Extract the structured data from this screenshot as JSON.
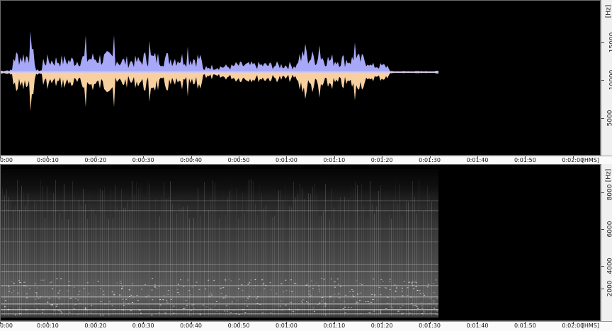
{
  "waveform": {
    "y_axis_unit": "[Hz]",
    "y_ticks": [
      "15000",
      "10000",
      "5000"
    ],
    "colors": {
      "upper": "#a8a8f8",
      "lower": "#f8d0a0",
      "background": "#000000"
    },
    "time_unit": "[HMS]",
    "time_ticks": [
      "0:00",
      "0:00:10",
      "0:00:20",
      "0:00:30",
      "0:00:40",
      "0:00:50",
      "0:01:00",
      "0:01:10",
      "0:01:20",
      "0:01:30",
      "0:01:40",
      "0:01:50",
      "0:02:00"
    ]
  },
  "spectrogram": {
    "y_axis_unit": "[Hz]",
    "y_ticks": [
      "8000",
      "6000",
      "4000",
      "2000"
    ],
    "colors": {
      "background": "#000000",
      "intensity": "#ffffff"
    },
    "time_unit": "[HMS]",
    "time_ticks": [
      "0:00",
      "0:00:10",
      "0:00:20",
      "0:00:30",
      "0:00:40",
      "0:00:50",
      "0:01:00",
      "0:01:10",
      "0:01:20",
      "0:01:30",
      "0:01:40",
      "0:01:50",
      "0:02:00"
    ]
  }
}
